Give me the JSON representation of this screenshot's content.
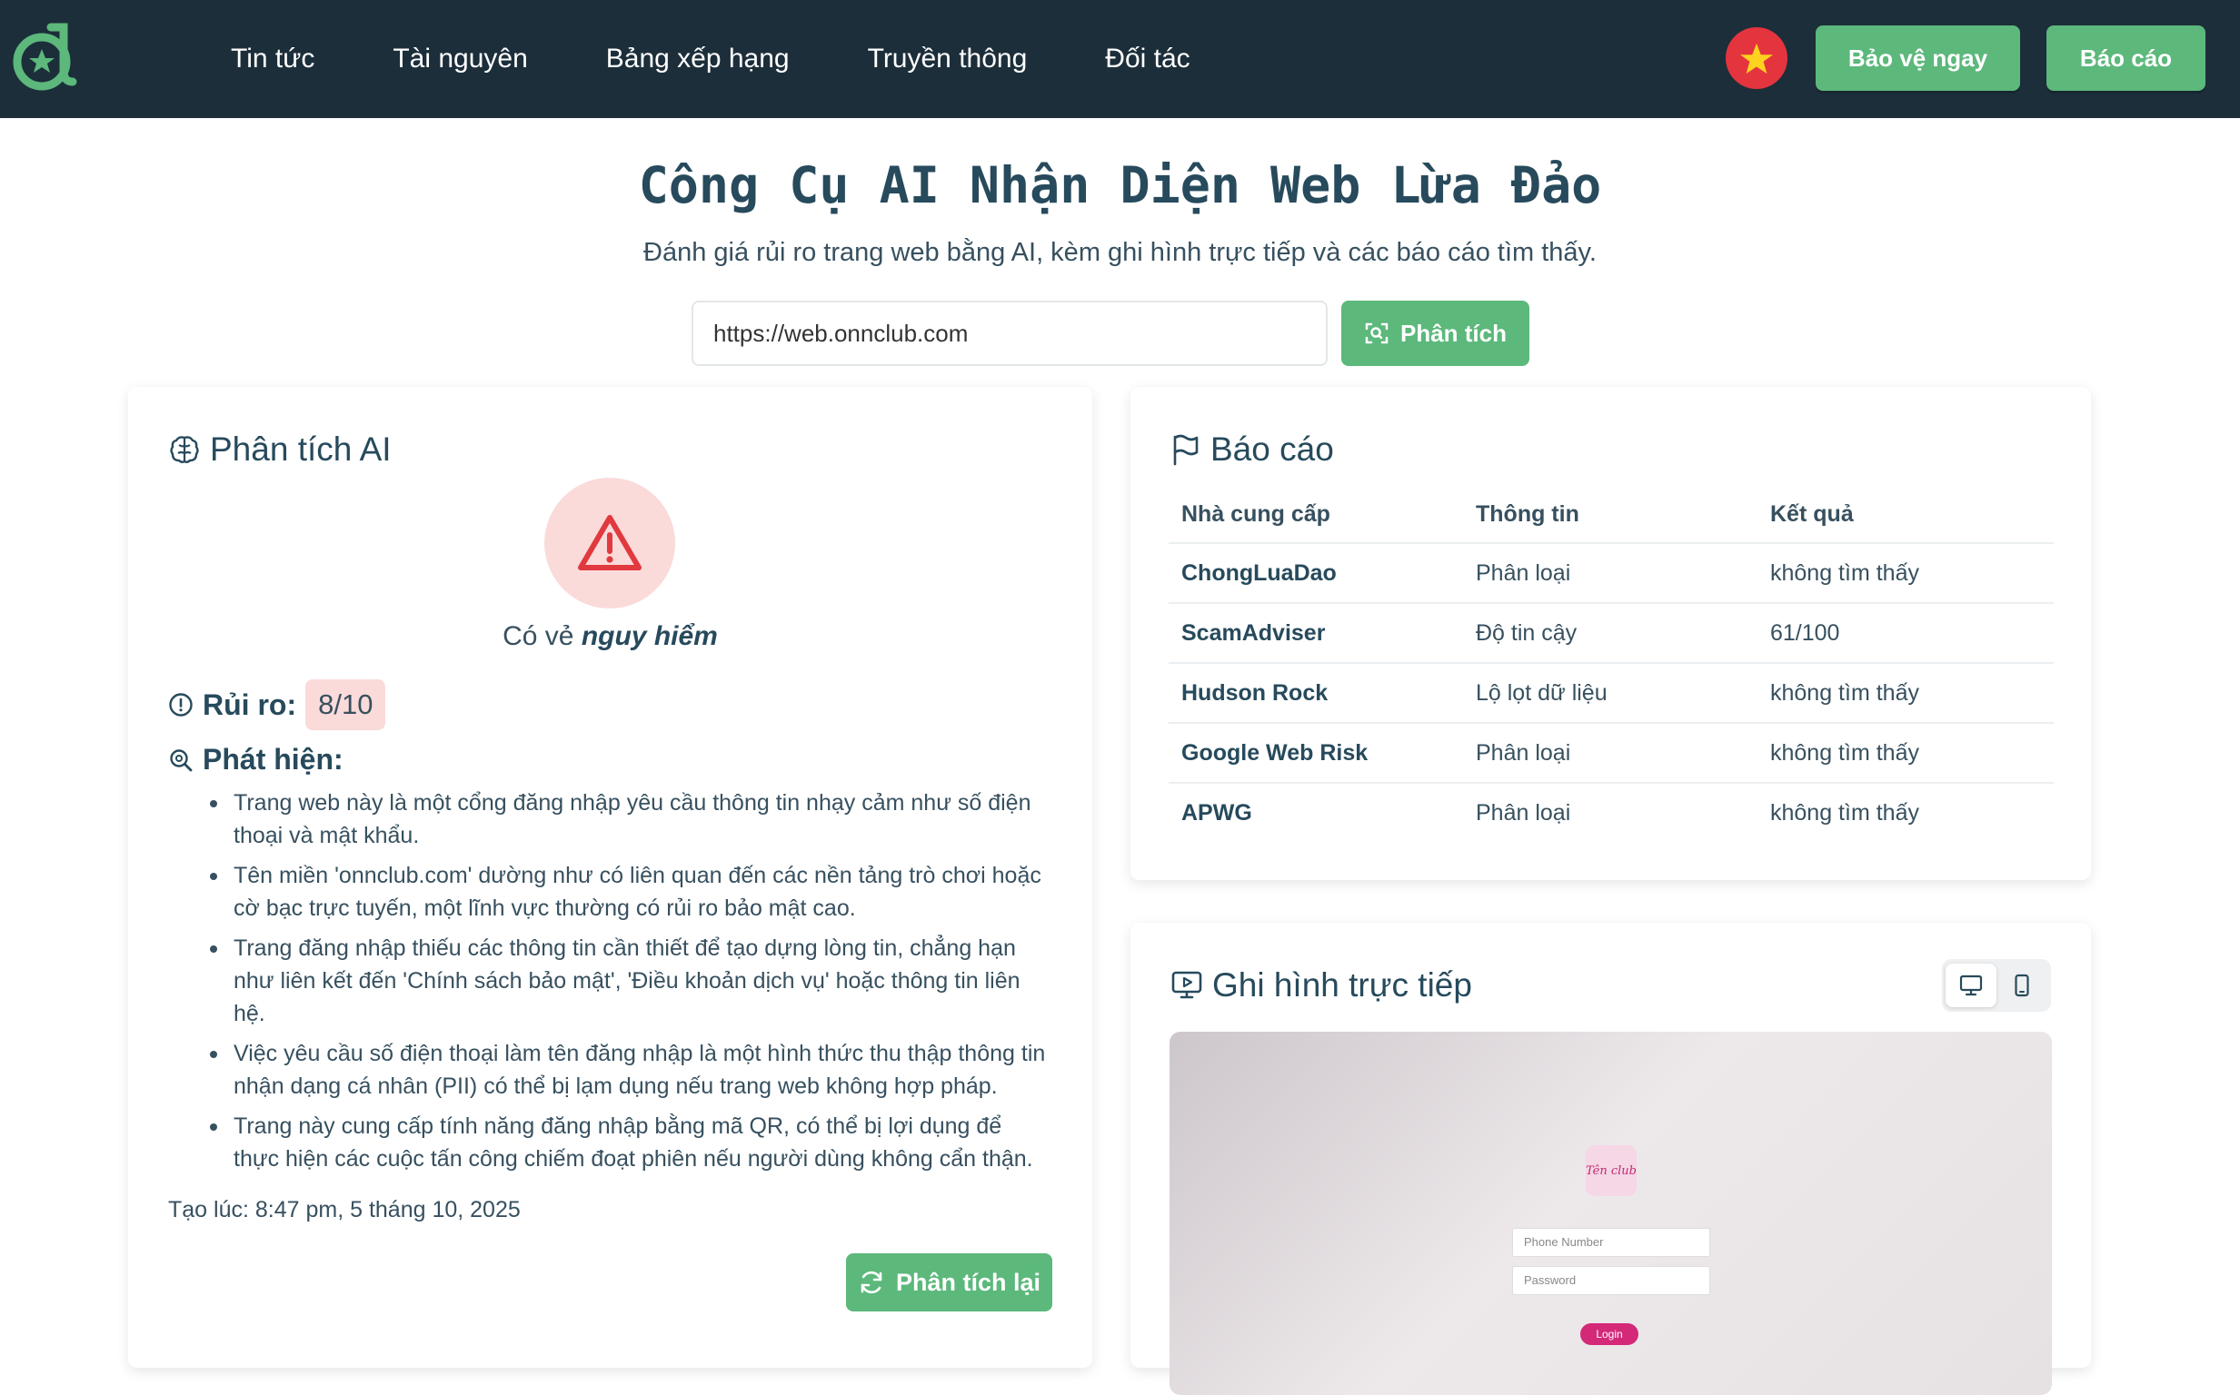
{
  "nav": {
    "items": [
      "Tin tức",
      "Tài nguyên",
      "Bảng xếp hạng",
      "Truyền thông",
      "Đối tác"
    ],
    "protect_label": "Bảo vệ ngay",
    "report_label": "Báo cáo",
    "language_icon": "vietnam-flag-icon"
  },
  "hero": {
    "title": "Công Cụ AI Nhận Diện Web Lừa Đảo",
    "subtitle": "Đánh giá rủi ro trang web bằng AI, kèm ghi hình trực tiếp và các báo cáo tìm thấy.",
    "url_value": "https://web.onnclub.com",
    "analyze_label": "Phân tích"
  },
  "ai": {
    "title": "Phân tích AI",
    "verdict_prefix": "Có vẻ",
    "verdict_word": "nguy hiểm",
    "risk_label": "Rủi ro:",
    "risk_value": "8/10",
    "findings_label": "Phát hiện:",
    "findings": [
      "Trang web này là một cổng đăng nhập yêu cầu thông tin nhạy cảm như số điện thoại và mật khẩu.",
      "Tên miền 'onnclub.com' dường như có liên quan đến các nền tảng trò chơi hoặc cờ bạc trực tuyến, một lĩnh vực thường có rủi ro bảo mật cao.",
      "Trang đăng nhập thiếu các thông tin cần thiết để tạo dựng lòng tin, chẳng hạn như liên kết đến 'Chính sách bảo mật', 'Điều khoản dịch vụ' hoặc thông tin liên hệ.",
      "Việc yêu cầu số điện thoại làm tên đăng nhập là một hình thức thu thập thông tin nhận dạng cá nhân (PII) có thể bị lạm dụng nếu trang web không hợp pháp.",
      "Trang này cung cấp tính năng đăng nhập bằng mã QR, có thể bị lợi dụng để thực hiện các cuộc tấn công chiếm đoạt phiên nếu người dùng không cẩn thận."
    ],
    "created": "Tạo lúc: 8:47 pm, 5 tháng 10, 2025",
    "reanalyze_label": "Phân tích lại"
  },
  "report": {
    "title": "Báo cáo",
    "columns": [
      "Nhà cung cấp",
      "Thông tin",
      "Kết quả"
    ],
    "rows": [
      [
        "ChongLuaDao",
        "Phân loại",
        "không tìm thấy"
      ],
      [
        "ScamAdviser",
        "Độ tin cậy",
        "61/100"
      ],
      [
        "Hudson Rock",
        "Lộ lọt dữ liệu",
        "không tìm thấy"
      ],
      [
        "Google Web Risk",
        "Phân loại",
        "không tìm thấy"
      ],
      [
        "APWG",
        "Phân loại",
        "không tìm thấy"
      ]
    ]
  },
  "live": {
    "title": "Ghi hình trực tiếp",
    "screenshot": {
      "logo_text": "Tên club",
      "phone_placeholder": "Phone Number",
      "password_placeholder": "Password",
      "login_label": "Login"
    }
  },
  "colors": {
    "nav_bg": "#1c2e3a",
    "accent_green": "#5cb87b",
    "danger_bg": "#fbdada",
    "danger": "#e0393e",
    "heading": "#274a5c"
  }
}
